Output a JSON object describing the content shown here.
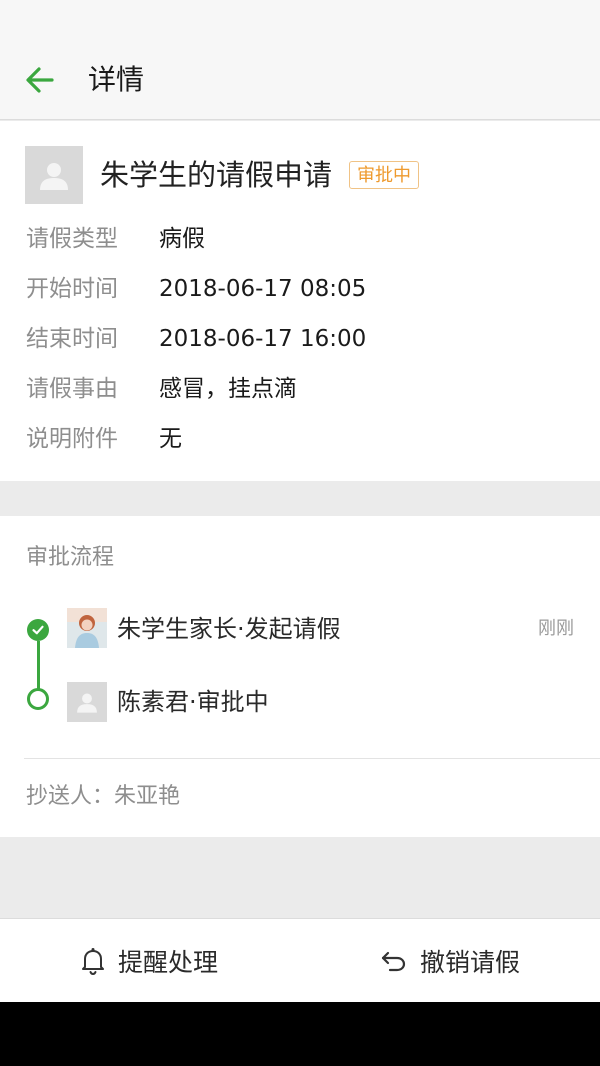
{
  "header": {
    "title": "详情"
  },
  "request": {
    "title": "朱学生的请假申请",
    "status": "审批中",
    "fields": [
      {
        "label": "请假类型",
        "value": "病假"
      },
      {
        "label": "开始时间",
        "value": "2018-06-17 08:05"
      },
      {
        "label": "结束时间",
        "value": "2018-06-17 16:00"
      },
      {
        "label": "请假事由",
        "value": "感冒，挂点滴"
      },
      {
        "label": "说明附件",
        "value": "无"
      }
    ]
  },
  "flow": {
    "title": "审批流程",
    "steps": [
      {
        "text": "朱学生家长·发起请假",
        "time": "刚刚",
        "state": "done"
      },
      {
        "text": "陈素君·审批中",
        "time": "",
        "state": "pending"
      }
    ],
    "cc": "抄送人：朱亚艳"
  },
  "footer": {
    "remind_label": "提醒处理",
    "revoke_label": "撤销请假"
  },
  "colors": {
    "accent_green": "#3ba73f",
    "badge_orange": "#ee9a2e"
  },
  "icons": [
    "back-arrow-icon",
    "user-placeholder-icon",
    "check-icon",
    "bell-icon",
    "undo-icon"
  ]
}
